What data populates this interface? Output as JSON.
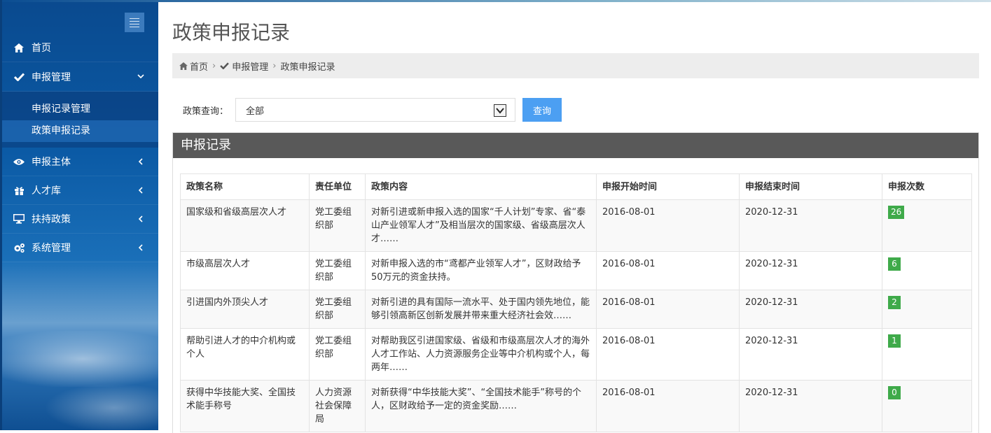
{
  "sidebar": {
    "items": [
      {
        "label": "首页",
        "icon": "home-icon"
      },
      {
        "label": "申报管理",
        "icon": "check-icon",
        "expanded": true,
        "children": [
          {
            "label": "申报记录管理"
          },
          {
            "label": "政策申报记录",
            "active": true
          }
        ]
      },
      {
        "label": "申报主体",
        "icon": "eye-icon"
      },
      {
        "label": "人才库",
        "icon": "gift-icon"
      },
      {
        "label": "扶持政策",
        "icon": "monitor-icon"
      },
      {
        "label": "系统管理",
        "icon": "gears-icon"
      }
    ]
  },
  "page": {
    "title": "政策申报记录",
    "breadcrumb": [
      {
        "label": "首页",
        "icon": "home-icon"
      },
      {
        "label": "申报管理",
        "icon": "check-icon"
      },
      {
        "label": "政策申报记录"
      }
    ]
  },
  "query": {
    "label": "政策查询：",
    "selected": "全部",
    "button": "查询"
  },
  "panel": {
    "title": "申报记录",
    "columns": [
      "政策名称",
      "责任单位",
      "政策内容",
      "申报开始时间",
      "申报结束时间",
      "申报次数"
    ],
    "rows": [
      {
        "name": "国家级和省级高层次人才",
        "unit": "党工委组织部",
        "content": "对新引进或新申报入选的国家“千人计划”专家、省“泰山产业领军人才”及相当层次的国家级、省级高层次人才……",
        "start": "2016-08-01",
        "end": "2020-12-31",
        "count": "26"
      },
      {
        "name": "市级高层次人才",
        "unit": "党工委组织部",
        "content": "对新申报入选的市“鸢都产业领军人才”，区财政给予50万元的资金扶持。",
        "start": "2016-08-01",
        "end": "2020-12-31",
        "count": "6"
      },
      {
        "name": "引进国内外顶尖人才",
        "unit": "党工委组织部",
        "content": "对新引进的具有国际一流水平、处于国内领先地位，能 够引领高新区创新发展并带来重大经济社会效……",
        "start": "2016-08-01",
        "end": "2020-12-31",
        "count": "2"
      },
      {
        "name": "帮助引进人才的中介机构或个人",
        "unit": "党工委组织部",
        "content": "对帮助我区引进国家级、省级和市级高层次人才的海外人才工作站、人力资源服务企业等中介机构或个人，每两年……",
        "start": "2016-08-01",
        "end": "2020-12-31",
        "count": "1"
      },
      {
        "name": "获得中华技能大奖、全国技术能手称号",
        "unit": "人力资源社会保障局",
        "content": "对新获得“中华技能大奖”、“全国技术能手”称号的个人，区财政给予一定的资金奖励……",
        "start": "2016-08-01",
        "end": "2020-12-31",
        "count": "0"
      }
    ]
  },
  "colors": {
    "accent": "#4c9ff2",
    "badge": "#3faa4a",
    "panel_header": "#595959"
  }
}
